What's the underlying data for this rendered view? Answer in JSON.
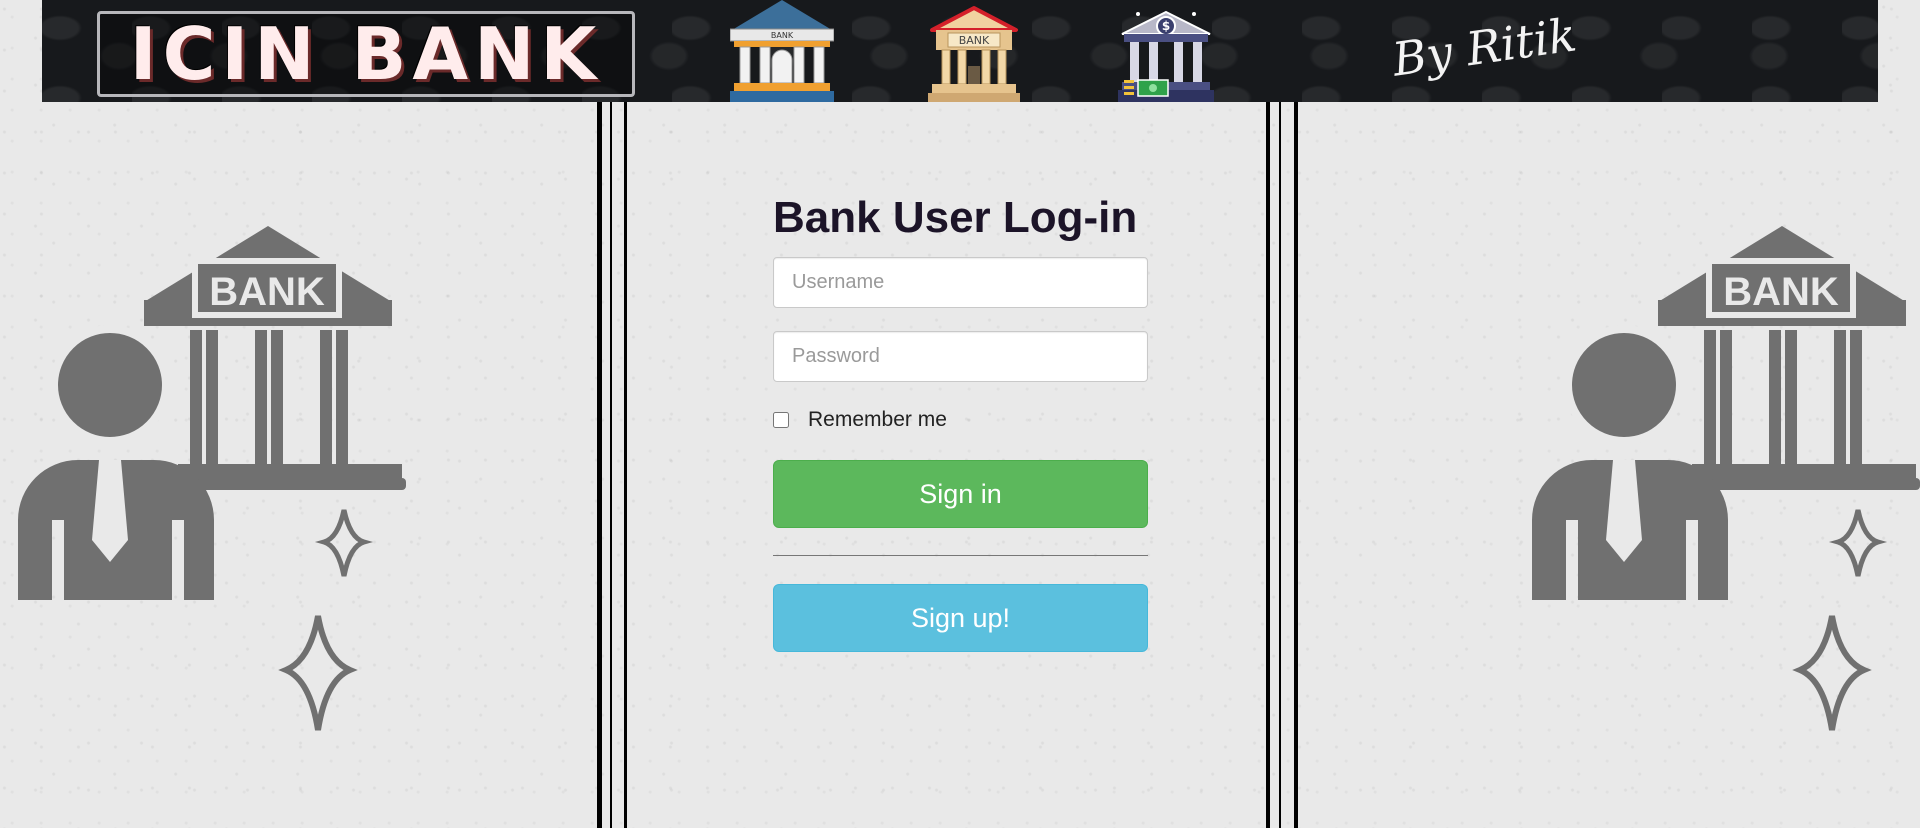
{
  "banner": {
    "logo_text": "ICIN BANK",
    "building_sign_small": "BANK",
    "building_sign_medium": "BANK",
    "bank_icon_symbol": "$",
    "signature": "By Ritik",
    "colors": {
      "background": "#17191c",
      "logo_text": "#ffecec"
    }
  },
  "illustration": {
    "sign_text": "BANK",
    "icon": "banker-building-icon",
    "color": "#707070"
  },
  "login": {
    "title": "Bank User Log-in",
    "username_placeholder": "Username",
    "password_placeholder": "Password",
    "remember_label": "Remember me",
    "signin_label": "Sign in",
    "signup_label": "Sign up!",
    "colors": {
      "signin": "#5cb85c",
      "signup": "#5bc0de",
      "title": "#1c1428"
    }
  }
}
